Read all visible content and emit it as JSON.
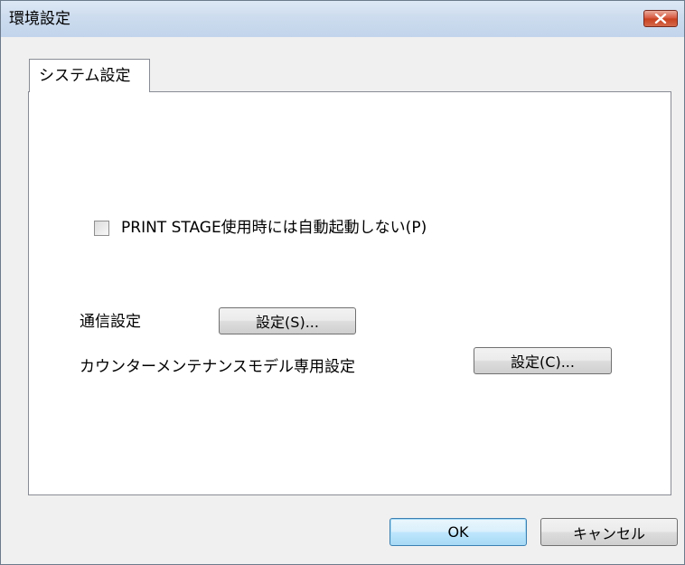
{
  "window": {
    "title": "環境設定"
  },
  "tabs": [
    {
      "label": "システム設定"
    }
  ],
  "system_settings": {
    "checkbox_label": "PRINT STAGE使用時には自動起動しない(P)",
    "checkbox_checked": false,
    "comm_label": "通信設定",
    "comm_button": "設定(S)...",
    "counter_label": "カウンターメンテナンスモデル専用設定",
    "counter_button": "設定(C)..."
  },
  "footer": {
    "ok": "OK",
    "cancel": "キャンセル"
  },
  "icons": {
    "close": "close-icon"
  }
}
